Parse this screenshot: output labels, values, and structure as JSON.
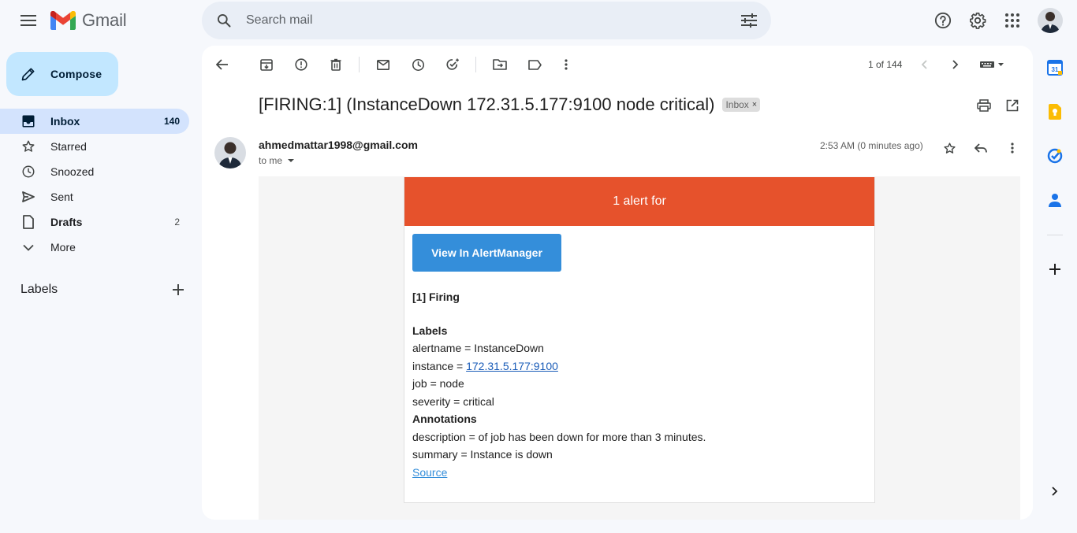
{
  "app": {
    "name": "Gmail",
    "search_placeholder": "Search mail"
  },
  "compose": {
    "label": "Compose"
  },
  "nav": {
    "items": [
      {
        "label": "Inbox",
        "count": "140"
      },
      {
        "label": "Starred",
        "count": ""
      },
      {
        "label": "Snoozed",
        "count": ""
      },
      {
        "label": "Sent",
        "count": ""
      },
      {
        "label": "Drafts",
        "count": "2"
      },
      {
        "label": "More",
        "count": ""
      }
    ],
    "labels_title": "Labels"
  },
  "toolbar": {
    "pager": "1 of 144"
  },
  "message": {
    "subject": "[FIRING:1] (InstanceDown 172.31.5.177:9100 node critical)",
    "chip": "Inbox",
    "chip_close": "×",
    "sender": "ahmedmattar1998@gmail.com",
    "to": "to me",
    "time": "2:53 AM (0 minutes ago)"
  },
  "email": {
    "banner": "1 alert for",
    "button": "View In AlertManager",
    "firing": "[1] Firing",
    "labels_title": "Labels",
    "alertname": "alertname = InstanceDown",
    "instance_prefix": "instance = ",
    "instance_link": "172.31.5.177:9100",
    "job": "job = node",
    "severity": "severity = critical",
    "annotations_title": "Annotations",
    "description": "description = of job has been down for more than 3 minutes.",
    "summary": "summary = Instance is down",
    "source": "Source"
  },
  "colors": {
    "banner": "#e6522c",
    "button": "#348eda",
    "compose_bg": "#c2e7ff",
    "nav_active": "#d3e3fd"
  }
}
